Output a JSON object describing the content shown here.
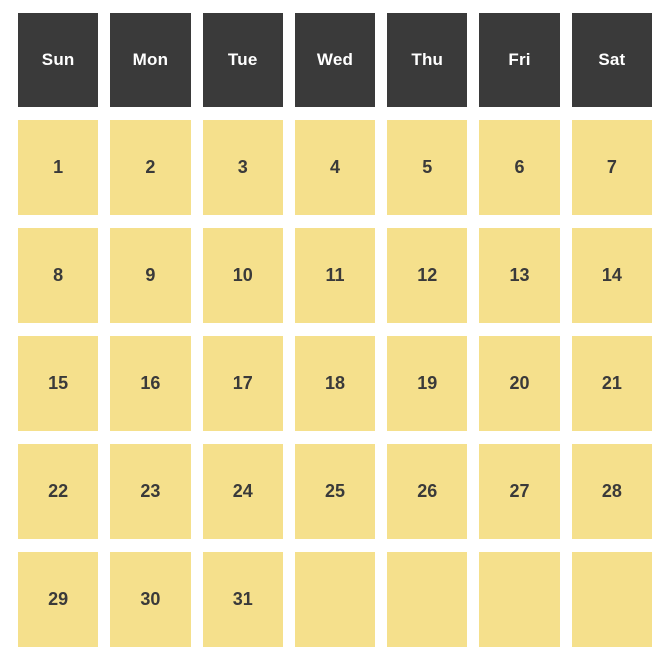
{
  "calendar": {
    "weekday_headers": [
      "Sun",
      "Mon",
      "Tue",
      "Wed",
      "Thu",
      "Fri",
      "Sat"
    ],
    "colors": {
      "header_background": "#3a3a3a",
      "header_text": "#ffffff",
      "day_background": "#f5e08c",
      "day_text": "#3a3a3a",
      "page_background": "#ffffff"
    },
    "weeks": [
      {
        "days": [
          "1",
          "2",
          "3",
          "4",
          "5",
          "6",
          "7"
        ]
      },
      {
        "days": [
          "8",
          "9",
          "10",
          "11",
          "12",
          "13",
          "14"
        ]
      },
      {
        "days": [
          "15",
          "16",
          "17",
          "18",
          "19",
          "20",
          "21"
        ]
      },
      {
        "days": [
          "22",
          "23",
          "24",
          "25",
          "26",
          "27",
          "28"
        ]
      },
      {
        "days": [
          "29",
          "30",
          "31",
          "",
          "",
          "",
          ""
        ]
      }
    ]
  }
}
